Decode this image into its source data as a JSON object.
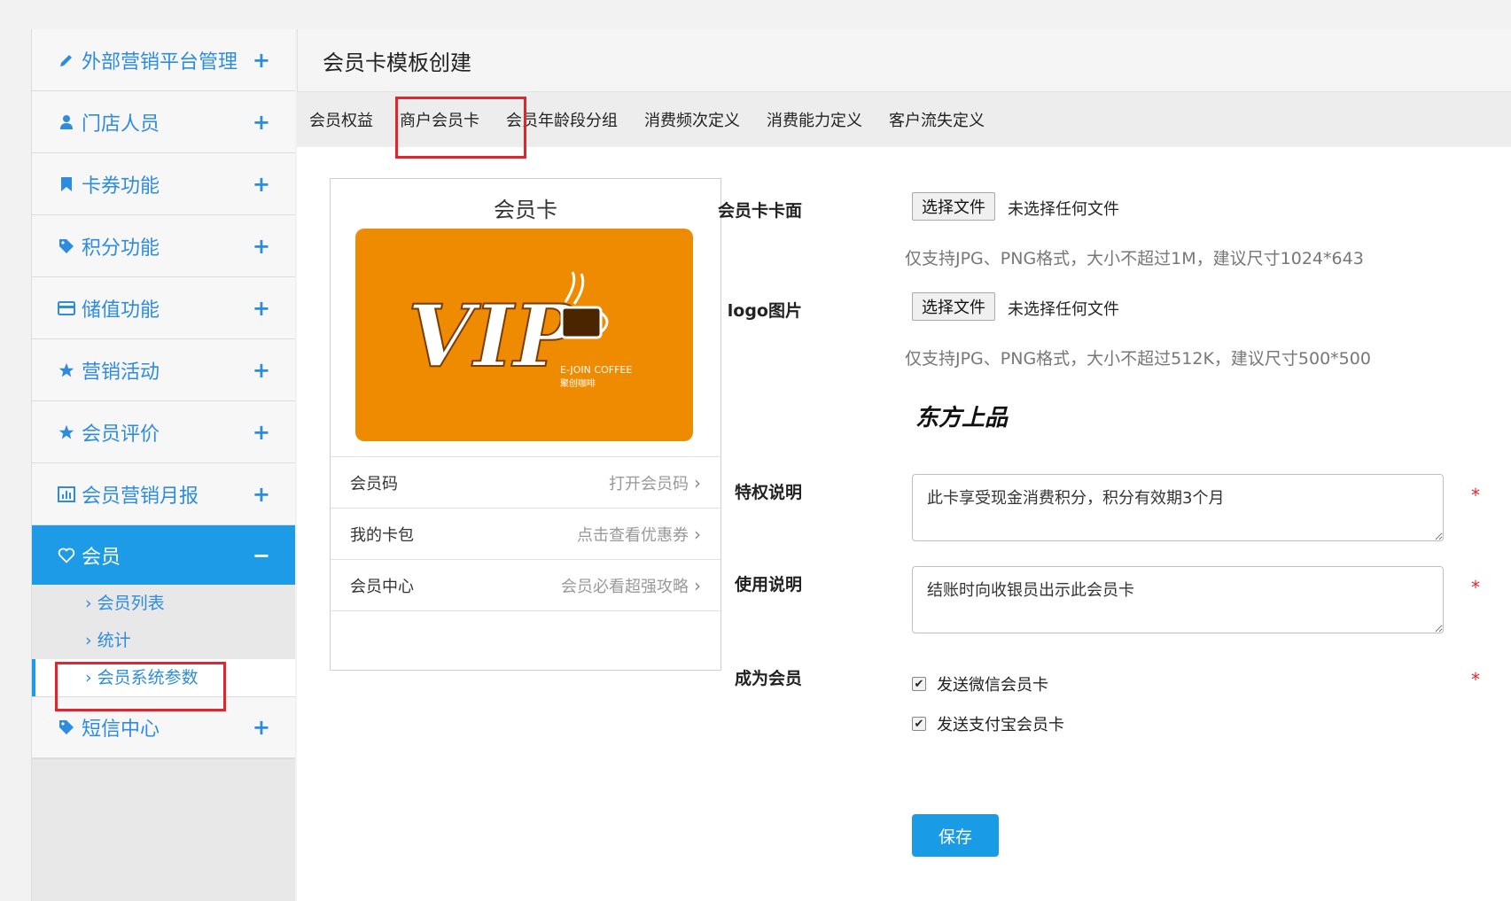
{
  "sidebar": {
    "items": [
      {
        "label": "外部营销平台管理",
        "icon": "pencil-icon",
        "toggle": "+"
      },
      {
        "label": "门店人员",
        "icon": "user-icon",
        "toggle": "+"
      },
      {
        "label": "卡券功能",
        "icon": "bookmark-icon",
        "toggle": "+"
      },
      {
        "label": "积分功能",
        "icon": "tag-icon",
        "toggle": "+"
      },
      {
        "label": "储值功能",
        "icon": "credit-card-icon",
        "toggle": "+"
      },
      {
        "label": "营销活动",
        "icon": "star-icon",
        "toggle": "+"
      },
      {
        "label": "会员评价",
        "icon": "star-icon",
        "toggle": "+"
      },
      {
        "label": "会员营销月报",
        "icon": "bar-chart-icon",
        "toggle": "+"
      },
      {
        "label": "会员",
        "icon": "heart-icon",
        "toggle": "−"
      }
    ],
    "sub_items": [
      "会员列表",
      "统计",
      "会员系统参数"
    ],
    "last_item": {
      "label": "短信中心",
      "icon": "tag-icon",
      "toggle": "+"
    },
    "accent_color": "#1e9be6"
  },
  "header": {
    "title": "会员卡模板创建"
  },
  "tabs": [
    "会员权益",
    "商户会员卡",
    "会员年龄段分组",
    "消费频次定义",
    "消费能力定义",
    "客户流失定义"
  ],
  "preview": {
    "title": "会员卡",
    "card": {
      "main_text": "VIP",
      "brand_en": "E-JOIN COFFEE",
      "brand_cn": "聚创咖啡",
      "color": "#ee8b00"
    },
    "rows": [
      {
        "label": "会员码",
        "value": "打开会员码"
      },
      {
        "label": "我的卡包",
        "value": "点击查看优惠券"
      },
      {
        "label": "会员中心",
        "value": "会员必看超强攻略"
      }
    ]
  },
  "form": {
    "card_face": {
      "label": "会员卡卡面",
      "button": "选择文件",
      "state": "未选择任何文件",
      "hint": "仅支持JPG、PNG格式，大小不超过1M，建议尺寸1024*643"
    },
    "logo": {
      "label": "logo图片",
      "button": "选择文件",
      "state": "未选择任何文件",
      "hint": "仅支持JPG、PNG格式，大小不超过512K，建议尺寸500*500",
      "logo_text": "东方上品"
    },
    "privilege": {
      "label": "特权说明",
      "value": "此卡享受现金消费积分，积分有效期3个月"
    },
    "usage": {
      "label": "使用说明",
      "value": "结账时向收银员出示此会员卡"
    },
    "become_member": {
      "label": "成为会员",
      "options": [
        "发送微信会员卡",
        "发送支付宝会员卡"
      ]
    },
    "required_mark": "*",
    "save_label": "保存"
  }
}
